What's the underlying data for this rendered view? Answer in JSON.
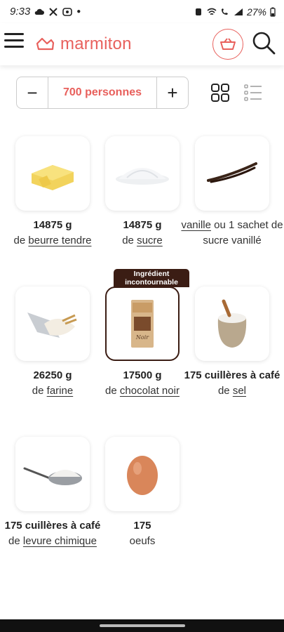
{
  "status": {
    "time": "9:33",
    "battery": "27%"
  },
  "header": {
    "logo_text": "marmiton",
    "menu_icon": "hamburger-menu-icon",
    "basket_icon": "basket-icon",
    "search_icon": "search-icon",
    "accent_color": "#e8605c"
  },
  "servings": {
    "minus": "−",
    "count": "700 personnes",
    "plus": "+"
  },
  "badge": {
    "line1": "Ingrédient",
    "line2": "incontournable"
  },
  "ingredients": [
    {
      "qty": "14875 g",
      "prefix": "de ",
      "name": "beurre tendre",
      "icon": "butter-icon"
    },
    {
      "qty": "14875 g",
      "prefix": "de ",
      "name": "sucre",
      "icon": "sugar-icon"
    },
    {
      "qty": "",
      "prefix": "",
      "name": "vanille",
      "suffix": " ou 1 sachet de sucre vanillé",
      "icon": "vanilla-icon"
    },
    {
      "qty": "26250 g",
      "prefix": "de ",
      "name": "farine",
      "icon": "flour-icon"
    },
    {
      "qty": "17500 g",
      "prefix": "de ",
      "name": "chocolat noir",
      "icon": "chocolate-icon"
    },
    {
      "qty": "175 cuillères à café",
      "prefix": "de ",
      "name": "sel",
      "icon": "salt-icon"
    },
    {
      "qty": "175 cuillères à café",
      "prefix": "de ",
      "name": "levure chimique",
      "icon": "baking-powder-icon"
    },
    {
      "qty": "175",
      "prefix": "",
      "name": "oeufs",
      "icon": "egg-icon"
    }
  ]
}
